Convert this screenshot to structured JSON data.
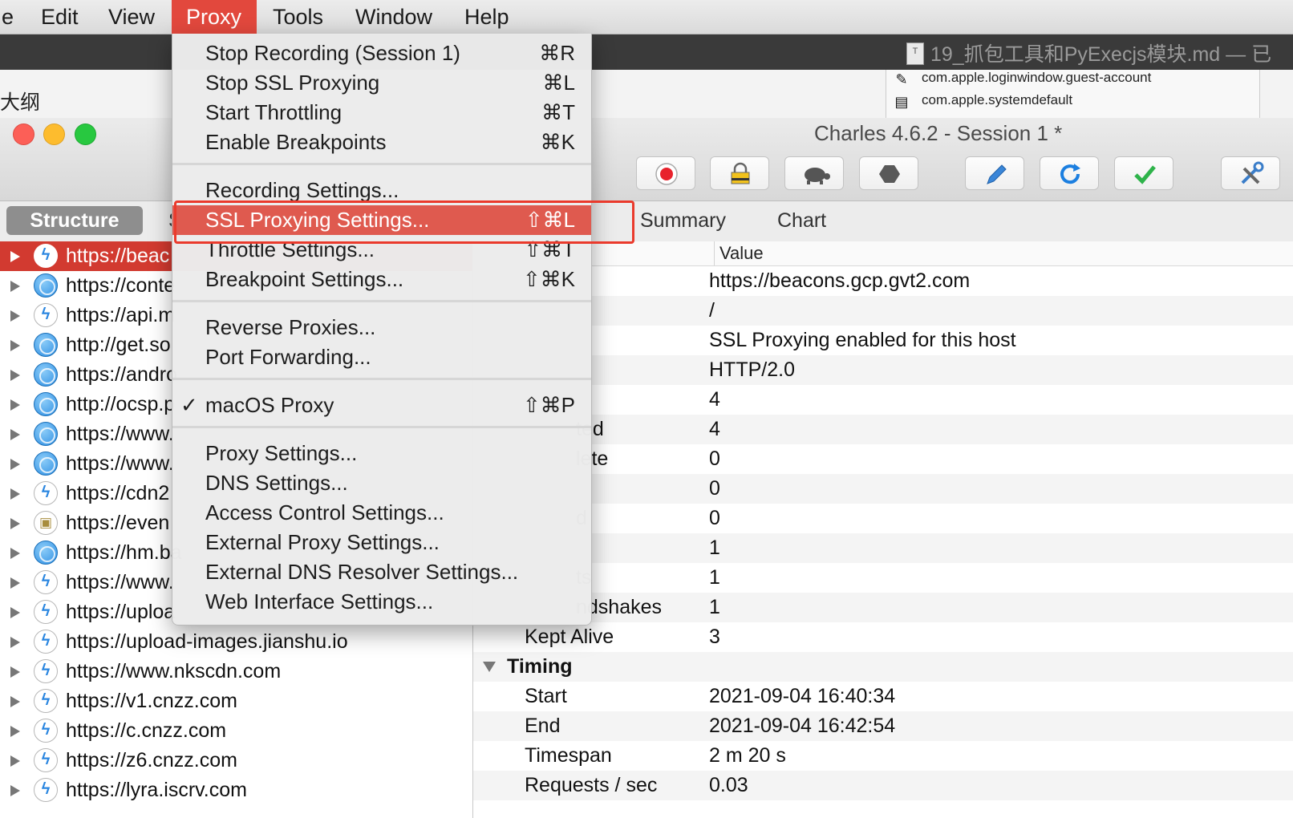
{
  "menubar": {
    "items": [
      "e",
      "Edit",
      "View",
      "Proxy",
      "Tools",
      "Window",
      "Help"
    ],
    "active": "Proxy"
  },
  "background": {
    "doc_title": "19_抓包工具和PyExecjs模块.md — 已",
    "outline_label": "大纲",
    "files": [
      "com.apple.loginwindow.guest-account",
      "com.apple.systemdefault"
    ]
  },
  "window": {
    "title": "Charles 4.6.2 - Session 1 *",
    "toolbar": [
      "record-icon",
      "ssl-lock-icon",
      "throttle-turtle-icon",
      "breakpoint-hexagon-icon",
      "compose-pen-icon",
      "repeat-refresh-icon",
      "validate-check-icon",
      "tools-icon"
    ]
  },
  "tabs": {
    "structure": "Structure",
    "sequence": "S",
    "summary": "Summary",
    "chart": "Chart"
  },
  "tree": [
    {
      "url": "https://beac",
      "icon": "bolt",
      "selected": true
    },
    {
      "url": "https://conte",
      "icon": "globe"
    },
    {
      "url": "https://api.m",
      "icon": "bolt"
    },
    {
      "url": "http://get.so",
      "icon": "globe"
    },
    {
      "url": "https://andro",
      "icon": "globe"
    },
    {
      "url": "http://ocsp.p",
      "icon": "globe"
    },
    {
      "url": "https://www.",
      "icon": "globe"
    },
    {
      "url": "https://www.",
      "icon": "globe"
    },
    {
      "url": "https://cdn2",
      "icon": "bolt"
    },
    {
      "url": "https://even",
      "icon": "lock"
    },
    {
      "url": "https://hm.ba",
      "icon": "globe"
    },
    {
      "url": "https://www.",
      "icon": "bolt"
    },
    {
      "url": "https://uploa",
      "icon": "bolt"
    },
    {
      "url": "https://upload-images.jianshu.io",
      "icon": "bolt"
    },
    {
      "url": "https://www.nkscdn.com",
      "icon": "bolt"
    },
    {
      "url": "https://v1.cnzz.com",
      "icon": "bolt"
    },
    {
      "url": "https://c.cnzz.com",
      "icon": "bolt"
    },
    {
      "url": "https://z6.cnzz.com",
      "icon": "bolt"
    },
    {
      "url": "https://lyra.iscrv.com",
      "icon": "bolt"
    }
  ],
  "table": {
    "value_header": "Value",
    "rows": [
      {
        "name": "",
        "value": "https://beacons.gcp.gvt2.com"
      },
      {
        "name": "",
        "value": "/"
      },
      {
        "name": "",
        "value": "SSL Proxying enabled for this host"
      },
      {
        "name": "",
        "value": "HTTP/2.0"
      },
      {
        "name": "",
        "value": "4"
      },
      {
        "name": "ted",
        "value": "4"
      },
      {
        "name": "lete",
        "value": "0"
      },
      {
        "name": "",
        "value": "0"
      },
      {
        "name": "d",
        "value": "0"
      },
      {
        "name": "",
        "value": "1"
      },
      {
        "name": "ts",
        "value": "1"
      },
      {
        "name": "ndshakes",
        "value": "1"
      },
      {
        "name": "Kept Alive",
        "value": "3"
      }
    ],
    "timing_group": "Timing",
    "timing": [
      {
        "name": "Start",
        "value": "2021-09-04 16:40:34"
      },
      {
        "name": "End",
        "value": "2021-09-04 16:42:54"
      },
      {
        "name": "Timespan",
        "value": "2 m 20 s"
      },
      {
        "name": "Requests / sec",
        "value": "0.03"
      }
    ]
  },
  "menu": {
    "groups": [
      [
        {
          "label": "Stop Recording (Session 1)",
          "key": "⌘R"
        },
        {
          "label": "Stop SSL Proxying",
          "key": "⌘L"
        },
        {
          "label": "Start Throttling",
          "key": "⌘T"
        },
        {
          "label": "Enable Breakpoints",
          "key": "⌘K"
        }
      ],
      [
        {
          "label": "Recording Settings...",
          "key": ""
        },
        {
          "label": "SSL Proxying Settings...",
          "key": "⇧⌘L",
          "highlighted": true
        },
        {
          "label": "Throttle Settings...",
          "key": "⇧⌘T"
        },
        {
          "label": "Breakpoint Settings...",
          "key": "⇧⌘K"
        }
      ],
      [
        {
          "label": "Reverse Proxies...",
          "key": ""
        },
        {
          "label": "Port Forwarding...",
          "key": ""
        }
      ],
      [
        {
          "label": "macOS Proxy",
          "key": "⇧⌘P",
          "checked": true,
          "check": "✓"
        }
      ],
      [
        {
          "label": "Proxy Settings...",
          "key": ""
        },
        {
          "label": "DNS Settings...",
          "key": ""
        },
        {
          "label": "Access Control Settings...",
          "key": ""
        },
        {
          "label": "External Proxy Settings...",
          "key": ""
        },
        {
          "label": "External DNS Resolver Settings...",
          "key": ""
        },
        {
          "label": "Web Interface Settings...",
          "key": ""
        }
      ]
    ]
  },
  "colors": {
    "accent": "#e2483d",
    "selection": "#d23a30",
    "highlight_box": "#ea3a2c",
    "menu_highlight": "#df5a4f"
  }
}
